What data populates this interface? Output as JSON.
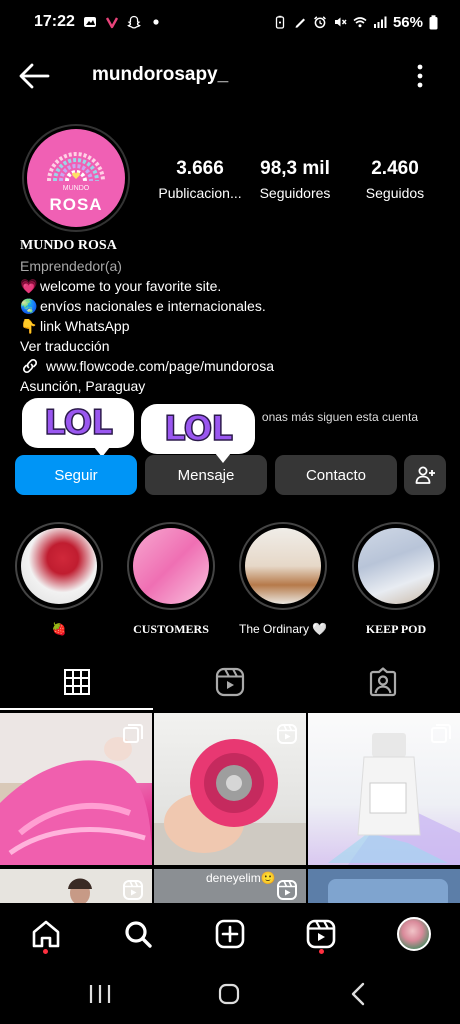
{
  "status_bar": {
    "time": "17:22",
    "battery": "56%"
  },
  "header": {
    "username": "mundorosapy_"
  },
  "profile": {
    "avatar_small_text": "MUNDO",
    "avatar_big_text": "ROSA",
    "stats": [
      {
        "value": "3.666",
        "label": "Publicacion..."
      },
      {
        "value": "98,3 mil",
        "label": "Seguidores"
      },
      {
        "value": "2.460",
        "label": "Seguidos"
      }
    ]
  },
  "bio": {
    "name": "MUNDO ROSA",
    "category": "Emprendedor(a)",
    "lines": [
      {
        "emoji": "💗",
        "text": "welcome to your favorite site."
      },
      {
        "emoji": "🌏",
        "text": "envíos nacionales e internacionales."
      },
      {
        "emoji": "👇",
        "text": "link WhatsApp"
      }
    ],
    "translate": "Ver traducción",
    "link": "www.flowcode.com/page/mundorosa",
    "location": "Asunción, Paraguay",
    "followed_by": "onas más siguen esta cuenta"
  },
  "stickers": {
    "sticker_1": "LOL",
    "sticker_2": "LOL"
  },
  "actions": {
    "follow": "Seguir",
    "message": "Mensaje",
    "contact": "Contacto"
  },
  "highlights": [
    {
      "label": "🍓"
    },
    {
      "label": "CUSTOMERS"
    },
    {
      "label": "The Ordinary 🤍"
    },
    {
      "label": "KEEP POD"
    }
  ],
  "grid": {
    "caption_5": "deneyelim🙂"
  },
  "colors": {
    "accent": "#0095f6",
    "secondary_button": "#363636",
    "avatar_pink": "#f060b4",
    "notification_dot": "#ff3040"
  },
  "icons": {
    "back": "arrow-left-icon",
    "more": "more-vertical-icon",
    "add_user": "add-user-icon",
    "grid": "grid-icon",
    "reels": "reels-icon",
    "tagged": "tagged-icon",
    "home": "home-icon",
    "search": "search-icon",
    "create": "create-icon",
    "profile": "profile-avatar"
  }
}
